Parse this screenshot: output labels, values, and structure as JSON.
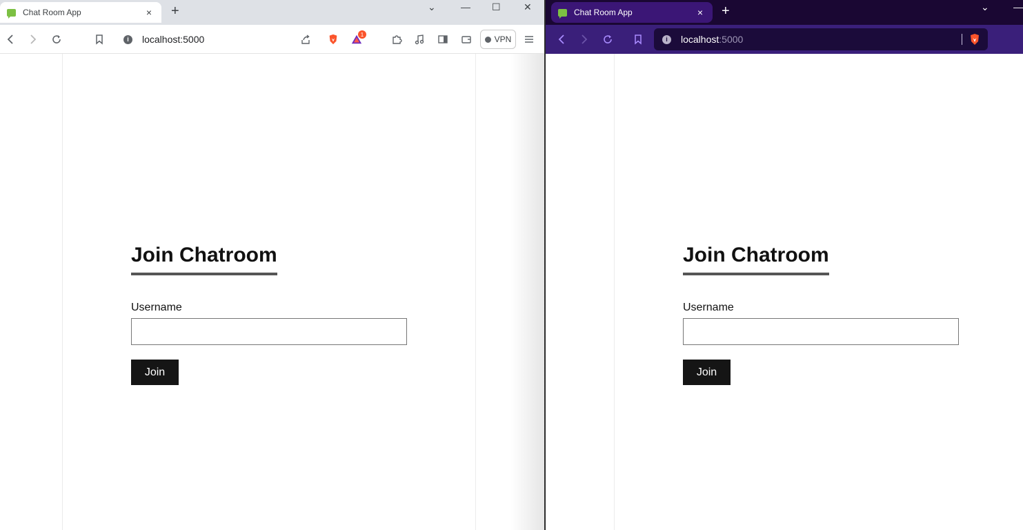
{
  "browser": {
    "tab_title": "Chat Room App",
    "tab_close": "×",
    "new_tab": "+",
    "url_host": "localhost",
    "url_port": ":5000",
    "url_full": "localhost:5000",
    "notification_count": "1",
    "vpn_label": "VPN",
    "minimize": "—",
    "maximize": "☐",
    "close": "✕",
    "tab_search": "⌄"
  },
  "page": {
    "heading": "Join Chatroom",
    "username_label": "Username",
    "username_value": "",
    "join_button": "Join"
  },
  "colors": {
    "left_tabstrip": "#dee1e6",
    "right_tabstrip": "#1a0733",
    "right_toolbar": "#3a1f7a",
    "join_button_bg": "#151515",
    "favicon": "#7cc043",
    "brave_orange": "#fb542b"
  }
}
